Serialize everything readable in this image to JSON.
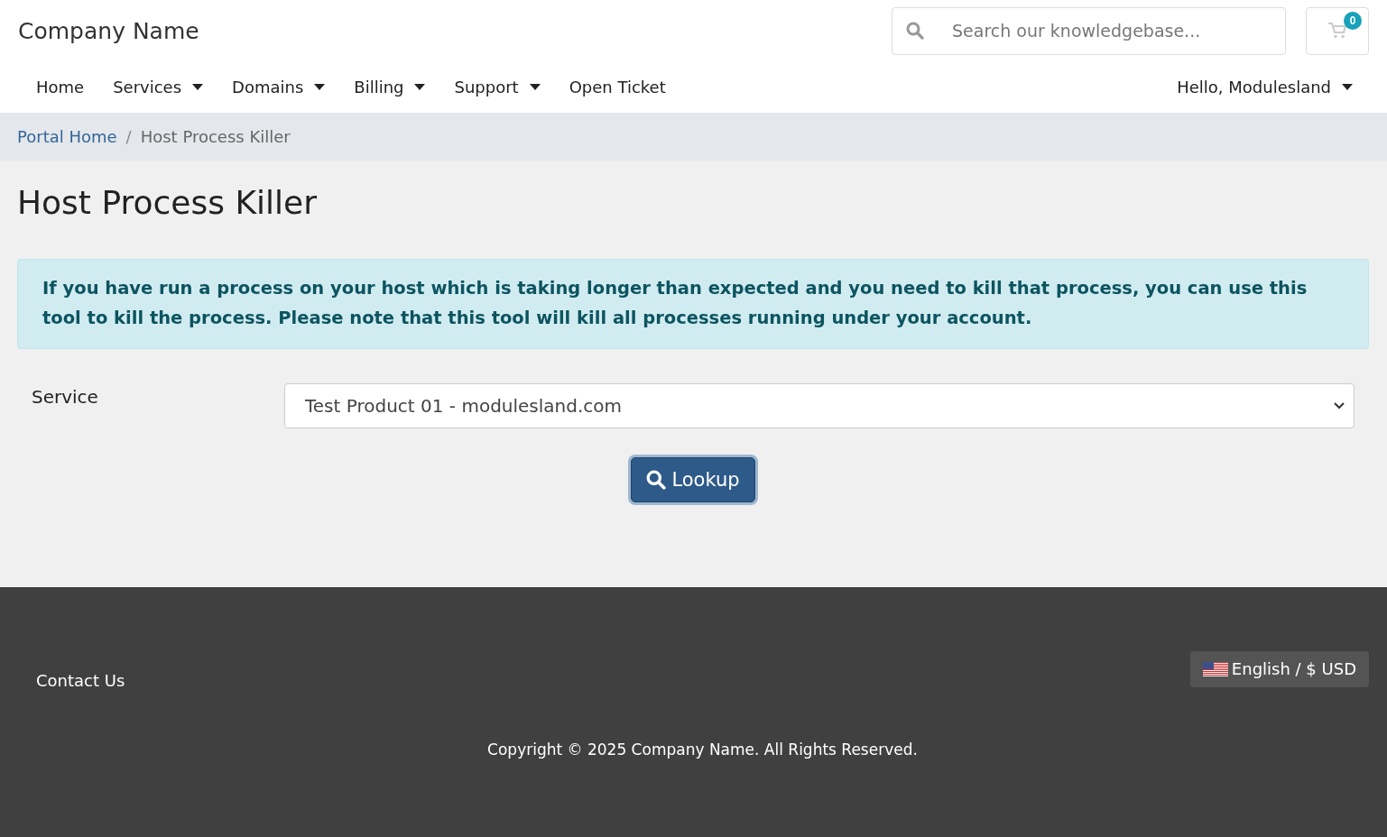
{
  "header": {
    "brand": "Company Name",
    "search": {
      "placeholder": "Search our knowledgebase..."
    },
    "cart_count": "0"
  },
  "nav": {
    "items": [
      {
        "label": "Home",
        "dropdown": false
      },
      {
        "label": "Services",
        "dropdown": true
      },
      {
        "label": "Domains",
        "dropdown": true
      },
      {
        "label": "Billing",
        "dropdown": true
      },
      {
        "label": "Support",
        "dropdown": true
      },
      {
        "label": "Open Ticket",
        "dropdown": false
      }
    ],
    "account": {
      "label": "Hello, Modulesland",
      "dropdown": true
    }
  },
  "breadcrumb": [
    {
      "label": "Portal Home",
      "link": true
    },
    {
      "label": "Host Process Killer",
      "link": false
    }
  ],
  "breadcrumb_separator": "/",
  "page_title": "Host Process Killer",
  "alert": "If you have run a process on your host which is taking longer than expected and you need to kill that process, you can use this tool to kill the process. Please note that this tool will kill all processes running under your account.",
  "form": {
    "label": "Service",
    "value": "Test Product 01 - modulesland.com",
    "button": "Lookup"
  },
  "footer": {
    "links": [
      "Contact Us"
    ],
    "language": "English / $ USD",
    "copyright": "Copyright © 2025 Company Name. All Rights Reserved."
  }
}
